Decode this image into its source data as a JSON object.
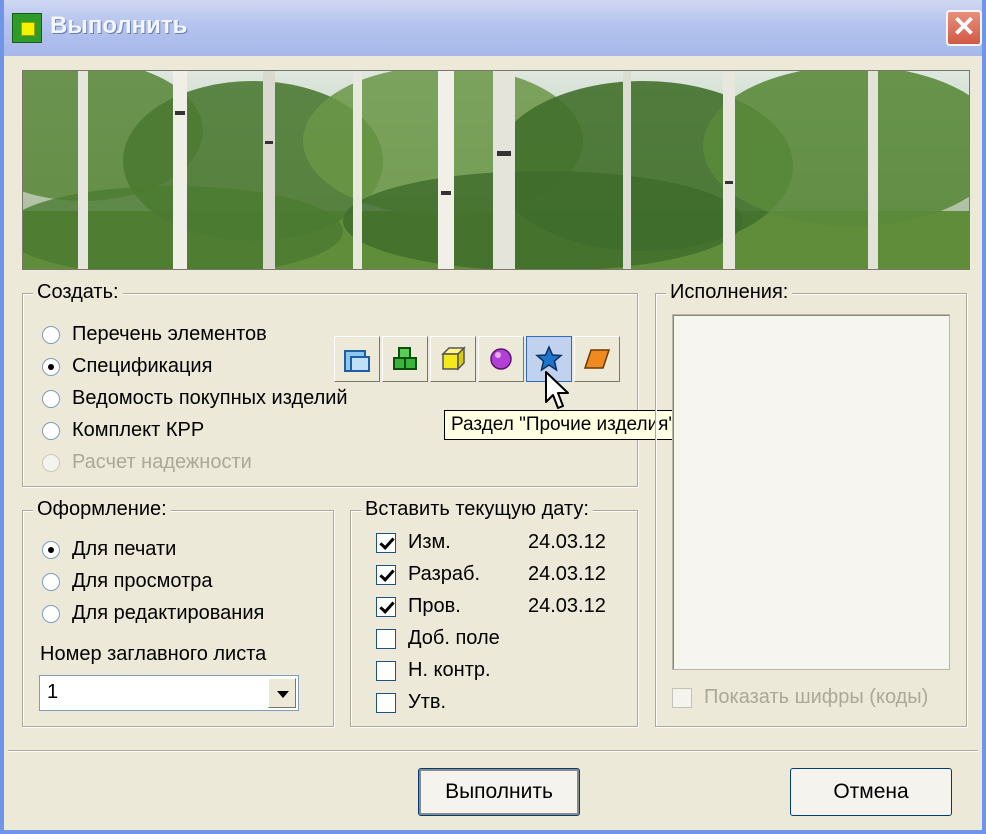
{
  "window": {
    "title": "Выполнить",
    "close_glyph": "✕"
  },
  "create_group": {
    "legend": "Создать:",
    "options": [
      {
        "label": "Перечень элементов",
        "selected": false,
        "enabled": true
      },
      {
        "label": "Спецификация",
        "selected": true,
        "enabled": true
      },
      {
        "label": "Ведомость покупных изделий",
        "selected": false,
        "enabled": true
      },
      {
        "label": "Комплект КРР",
        "selected": false,
        "enabled": true
      },
      {
        "label": "Расчет надежности",
        "selected": false,
        "enabled": false
      }
    ],
    "section_buttons": [
      "folder-icon",
      "green-blocks-icon",
      "yellow-cube-icon",
      "purple-sphere-icon",
      "blue-star-icon",
      "orange-parallelogram-icon"
    ],
    "tooltip": "Раздел \"Прочие изделия\""
  },
  "executions_group": {
    "legend": "Исполнения:",
    "show_codes_label": "Показать шифры (коды)"
  },
  "format_group": {
    "legend": "Оформление:",
    "options": [
      {
        "label": "Для печати",
        "selected": true
      },
      {
        "label": "Для просмотра",
        "selected": false
      },
      {
        "label": "Для редактирования",
        "selected": false
      }
    ],
    "title_sheet_label": "Номер заглавного листа",
    "title_sheet_value": "1"
  },
  "date_group": {
    "legend": "Вставить текущую дату:",
    "items": [
      {
        "label": "Изм.",
        "checked": true,
        "date": "24.03.12"
      },
      {
        "label": "Разраб.",
        "checked": true,
        "date": "24.03.12"
      },
      {
        "label": "Пров.",
        "checked": true,
        "date": "24.03.12"
      },
      {
        "label": "Доб. поле",
        "checked": false,
        "date": ""
      },
      {
        "label": "Н. контр.",
        "checked": false,
        "date": ""
      },
      {
        "label": "Утв.",
        "checked": false,
        "date": ""
      }
    ]
  },
  "buttons": {
    "ok": "Выполнить",
    "cancel": "Отмена"
  },
  "colors": {
    "titlebar": "#b4c3ee",
    "dialog_bg": "#ece9d8",
    "close": "#cf5a44",
    "tooltip_bg": "#ffffe1"
  }
}
